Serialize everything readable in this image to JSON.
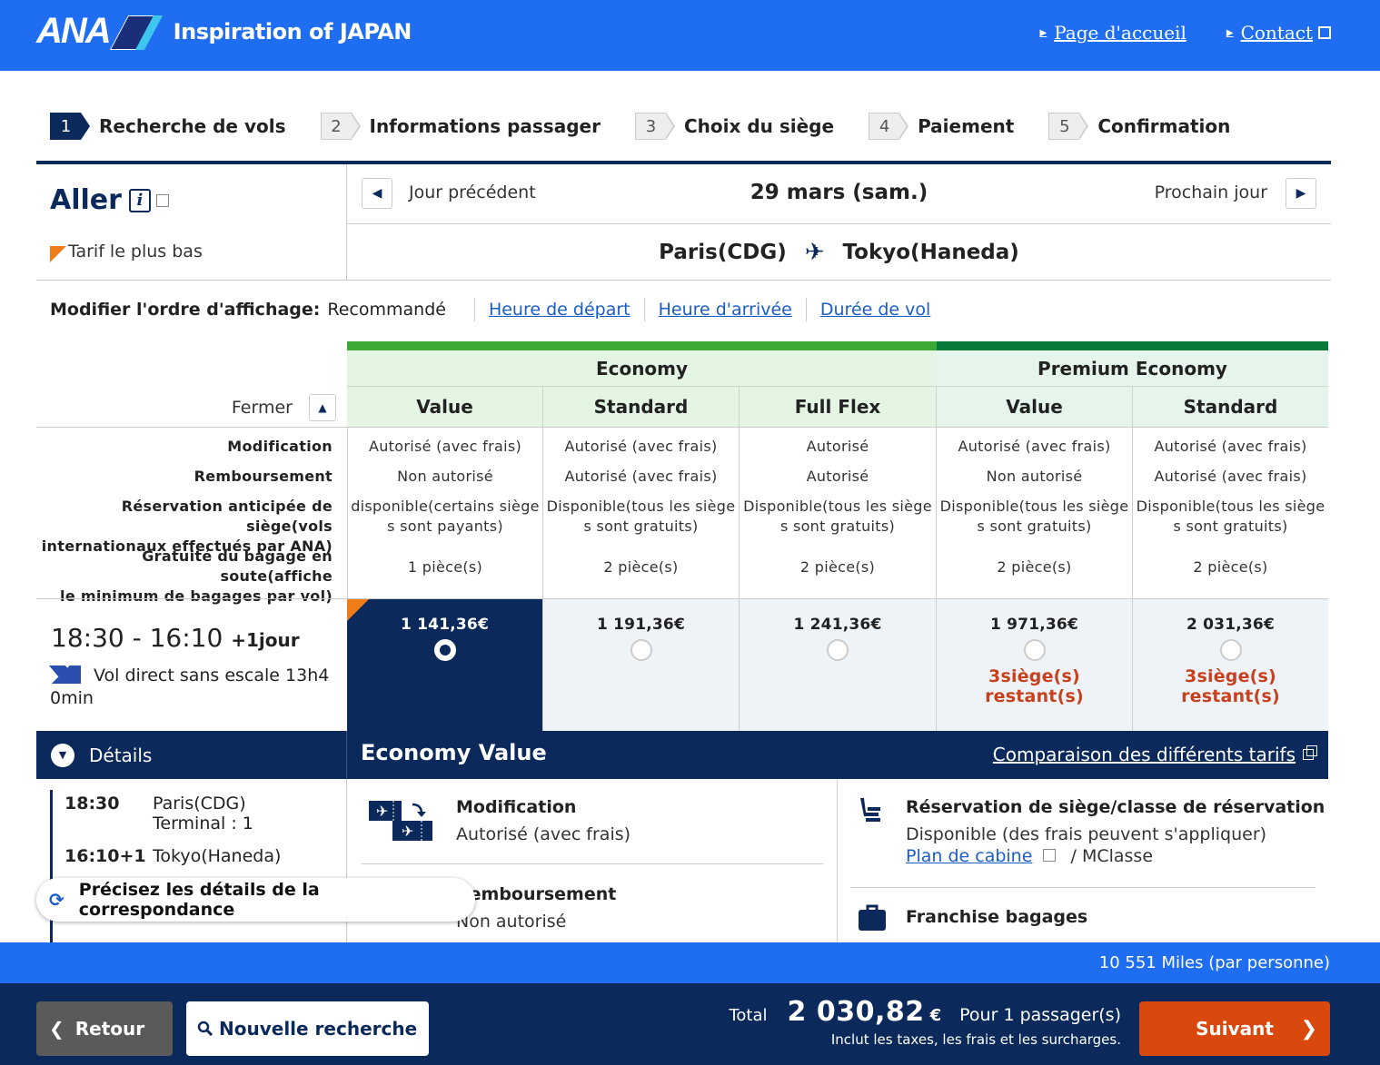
{
  "header": {
    "logo_text": "ANA",
    "tagline": "Inspiration of JAPAN",
    "links": [
      {
        "label": "Page d'accueil"
      },
      {
        "label": "Contact"
      }
    ]
  },
  "steps": [
    {
      "num": "1",
      "label": "Recherche de vols",
      "active": true
    },
    {
      "num": "2",
      "label": "Informations passager",
      "active": false
    },
    {
      "num": "3",
      "label": "Choix du siège",
      "active": false
    },
    {
      "num": "4",
      "label": "Paiement",
      "active": false
    },
    {
      "num": "5",
      "label": "Confirmation",
      "active": false
    }
  ],
  "direction": {
    "title": "Aller",
    "lowest_fare_legend": "Tarif le plus bas",
    "prev_day": "Jour précédent",
    "next_day": "Prochain jour",
    "date": "29 mars (sam.)",
    "origin": "Paris(CDG)",
    "destination": "Tokyo(Haneda)"
  },
  "sort": {
    "title": "Modifier l'ordre d'affichage:",
    "current": "Recommandé",
    "options": [
      "Heure de départ",
      "Heure d'arrivée",
      "Durée de vol"
    ]
  },
  "fare_table": {
    "collapse_label": "Fermer",
    "cabins": [
      {
        "name": "Economy",
        "color": "#3daa35"
      },
      {
        "name": "Premium Economy",
        "color": "#0a7a3a"
      }
    ],
    "attribute_labels": {
      "modification": "Modification",
      "refund": "Remboursement",
      "seat": "Réservation anticipée de siège(vols internationaux effectués par ANA)",
      "seat_line1": "Réservation anticipée de siège(vols",
      "seat_line2": "internationaux effectués par ANA)",
      "baggage_line1": "Gratuité du bagage en soute(affiche",
      "baggage_line2": "le minimum de bagages par vol)"
    },
    "fares": [
      {
        "name": "Value",
        "cabin": "Economy",
        "modification": "Autorisé (avec frais)",
        "refund": "Non autorisé",
        "seat_line1": "disponible(certains siège",
        "seat_line2": "s sont payants)",
        "baggage": "1 pièce(s)",
        "price": "1 141,36€",
        "selected": true,
        "lowest": true,
        "seats_left": ""
      },
      {
        "name": "Standard",
        "cabin": "Economy",
        "modification": "Autorisé (avec frais)",
        "refund": "Autorisé (avec frais)",
        "seat_line1": "Disponible(tous les siège",
        "seat_line2": "s sont gratuits)",
        "baggage": "2 pièce(s)",
        "price": "1 191,36€",
        "selected": false,
        "lowest": false,
        "seats_left": ""
      },
      {
        "name": "Full Flex",
        "cabin": "Economy",
        "modification": "Autorisé",
        "refund": "Autorisé",
        "seat_line1": "Disponible(tous les siège",
        "seat_line2": "s sont gratuits)",
        "baggage": "2 pièce(s)",
        "price": "1 241,36€",
        "selected": false,
        "lowest": false,
        "seats_left": ""
      },
      {
        "name": "Value",
        "cabin": "Premium Economy",
        "modification": "Autorisé (avec frais)",
        "refund": "Non autorisé",
        "seat_line1": "Disponible(tous les siège",
        "seat_line2": "s sont gratuits)",
        "baggage": "2 pièce(s)",
        "price": "1 971,36€",
        "selected": false,
        "lowest": false,
        "seats_left": "3siège(s) restant(s)"
      },
      {
        "name": "Standard",
        "cabin": "Premium Economy",
        "modification": "Autorisé (avec frais)",
        "refund": "Autorisé (avec frais)",
        "seat_line1": "Disponible(tous les siège",
        "seat_line2": "s sont gratuits)",
        "baggage": "2 pièce(s)",
        "price": "2 031,36€",
        "selected": false,
        "lowest": false,
        "seats_left": "3siège(s) restant(s)"
      }
    ]
  },
  "flight": {
    "times": "18:30 - 16:10",
    "day_offset": "+1jour",
    "description_line1": "Vol direct sans escale 13h4",
    "description_line2": "0min"
  },
  "details": {
    "toggle_label": "Détails",
    "selected_fare": "Economy Value",
    "compare_link": "Comparaison des différents tarifs",
    "segments": [
      {
        "time": "18:30",
        "place": "Paris(CDG)",
        "extra": "Terminal : 1"
      },
      {
        "time": "16:10+1",
        "place": "Tokyo(Haneda)",
        "extra": ""
      }
    ],
    "conditions": {
      "modification_title": "Modification",
      "modification_value": "Autorisé (avec frais)",
      "refund_title": "Remboursement",
      "refund_value": "Non autorisé",
      "seat_title": "Réservation de siège/classe de réservation",
      "seat_value": "Disponible (des frais peuvent s'appliquer)",
      "cabin_plan_link": "Plan de cabine",
      "booking_class": "/ MClasse",
      "baggage_title": "Franchise bagages"
    },
    "connection_pill": "Précisez les détails de la correspondance"
  },
  "footer": {
    "miles": "10 551 Miles (par personne)",
    "back_label": "Retour",
    "new_search_label": "Nouvelle recherche",
    "total_label": "Total",
    "total_amount": "2 030,82",
    "currency": "€",
    "passengers": "Pour 1 passager(s)",
    "note": "Inclut les taxes, les frais et les surcharges.",
    "next_label": "Suivant"
  },
  "colors": {
    "brand_blue": "#1f6ef2",
    "navy": "#0b2a5b",
    "economy_green": "#3daa35",
    "premium_green": "#0a7a3a",
    "lowest_fare_orange": "#f07c18",
    "seats_left_red": "#c8401c",
    "next_button": "#d9480c"
  }
}
